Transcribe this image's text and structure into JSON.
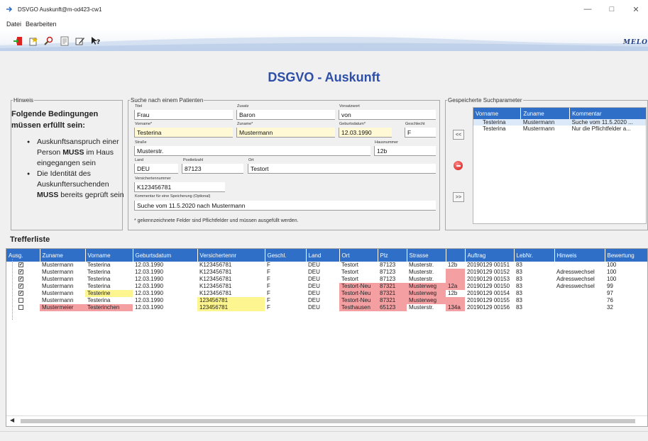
{
  "window": {
    "title": "DSVGO Auskunft@m-od423-cw1"
  },
  "menu": {
    "items": [
      "Datei",
      "Bearbeiten"
    ]
  },
  "toolbar": {
    "logo": "MELO"
  },
  "page_title": "DSGVO - Auskunft",
  "hint": {
    "legend": "Hinweis",
    "title": "Folgende Bedingungen müssen erfüllt sein:",
    "items": [
      {
        "before": "Auskunftsanspruch einer Person ",
        "bold": "MUSS",
        "after": " im Haus eingegangen sein"
      },
      {
        "before": "Die Identität des Auskunftersuchenden ",
        "bold": "MUSS",
        "after": " bereits geprüft sein"
      }
    ]
  },
  "search": {
    "legend": "Suche nach einem Patienten",
    "fields": {
      "titel": {
        "label": "Titel",
        "value": "Frau"
      },
      "zusatz": {
        "label": "Zusatz",
        "value": "Baron"
      },
      "vorsatzwort": {
        "label": "Vorsatzwort",
        "value": "von"
      },
      "vorname": {
        "label": "Vorname*",
        "value": "Testerina"
      },
      "zuname": {
        "label": "Zuname*",
        "value": "Mustermann"
      },
      "geburtsdatum": {
        "label": "Geburtsdatum*",
        "value": "12.03.1990"
      },
      "geschlecht": {
        "label": "Geschlecht",
        "value": "F"
      },
      "strasse": {
        "label": "Straße",
        "value": "Musterstr."
      },
      "hausnummer": {
        "label": "Hausnummer",
        "value": "12b"
      },
      "land": {
        "label": "Land",
        "value": "DEU"
      },
      "postleitzahl": {
        "label": "Postleitzahl",
        "value": "87123"
      },
      "ort": {
        "label": "Ort",
        "value": "Testort"
      },
      "versichertennummer": {
        "label": "Versichertennummer",
        "value": "K123456781"
      },
      "kommentar": {
        "label": "Kommentar für eine Speicherung (Optional)",
        "value": "Suche vom 11.5.2020 nach Mustermann"
      }
    },
    "footnote": "* gekennzeichnete Felder sind Pflichtfelder und müssen ausgefüllt werden."
  },
  "saved": {
    "legend": "Gespeicherte Suchparameter",
    "btn_load": "<<",
    "btn_save": ">>",
    "columns": [
      "Vorname",
      "Zuname",
      "Kommentar"
    ],
    "rows": [
      [
        "Testerina",
        "Mustermann",
        "Suche vom 11.5.2020 ..."
      ],
      [
        "Testerina",
        "Mustermann",
        "Nur die Pflichtfelder a..."
      ]
    ]
  },
  "results": {
    "title": "Trefferliste",
    "columns": [
      "Ausg.",
      "Zuname",
      "Vorname",
      "Geburtsdatum",
      "Versichertennr",
      "Geschl.",
      "Land",
      "Ort",
      "Plz",
      "Strasse",
      "",
      "Auftrag",
      "LebNr.",
      "Hinweis",
      "Bewertung"
    ],
    "rows": [
      {
        "checked": true,
        "cells": [
          "Mustermann",
          "Testerina",
          "12.03.1990",
          "K123456781",
          "F",
          "DEU",
          "Testort",
          "87123",
          "Musterstr.",
          "12b",
          "20190129 00151",
          "83",
          "",
          "100"
        ],
        "hl": {}
      },
      {
        "checked": true,
        "cells": [
          "Mustermann",
          "Testerina",
          "12.03.1990",
          "K123456781",
          "F",
          "DEU",
          "Testort",
          "87123",
          "Musterstr.",
          "",
          "20190129 00152",
          "83",
          "Adresswechsel",
          "100"
        ],
        "hl": {
          "9": "r"
        }
      },
      {
        "checked": true,
        "cells": [
          "Mustermann",
          "Testerina",
          "12.03.1990",
          "K123456781",
          "F",
          "DEU",
          "Testort",
          "87123",
          "Musterstr.",
          "",
          "20190129 00153",
          "83",
          "Adresswechsel",
          "100"
        ],
        "hl": {
          "9": "r"
        }
      },
      {
        "checked": true,
        "cells": [
          "Mustermann",
          "Testerina",
          "12.03.1990",
          "K123456781",
          "F",
          "DEU",
          "Testort-Neu",
          "87321",
          "Musterweg",
          "12a",
          "20190129 00150",
          "83",
          "Adresswechsel",
          "99"
        ],
        "hl": {
          "6": "r",
          "7": "r",
          "8": "r",
          "9": "r"
        }
      },
      {
        "checked": true,
        "cells": [
          "Mustermann",
          "Testerine",
          "12.03.1990",
          "K123456781",
          "F",
          "DEU",
          "Testort-Neu",
          "87321",
          "Musterweg",
          "12b",
          "20190129 00154",
          "83",
          "",
          "97"
        ],
        "hl": {
          "1": "y",
          "6": "r",
          "7": "r",
          "8": "r"
        }
      },
      {
        "checked": false,
        "cells": [
          "Mustermann",
          "Testerina",
          "12.03.1990",
          "123456781",
          "F",
          "DEU",
          "Testort-Neu",
          "87321",
          "Musterweg",
          "",
          "20190129 00155",
          "83",
          "",
          "76"
        ],
        "hl": {
          "3": "y",
          "6": "r",
          "7": "r",
          "8": "r",
          "9": "r"
        }
      },
      {
        "checked": false,
        "cells": [
          "Mustermeier",
          "Testerinchen",
          "12.03.1990",
          "123456781",
          "F",
          "DEU",
          "Testhausen",
          "65123",
          "Musterstr.",
          "134a",
          "20190129 00156",
          "83",
          "",
          "32"
        ],
        "hl": {
          "0": "r",
          "1": "r",
          "3": "y",
          "6": "r",
          "7": "r",
          "9": "r"
        }
      }
    ]
  },
  "colors": {
    "header_blue": "#2f6fc8",
    "title_blue": "#2e4fa8",
    "required_yellow": "#fff9d5",
    "diff_yellow": "#fdf58f",
    "diff_red": "#f4a0a3"
  }
}
